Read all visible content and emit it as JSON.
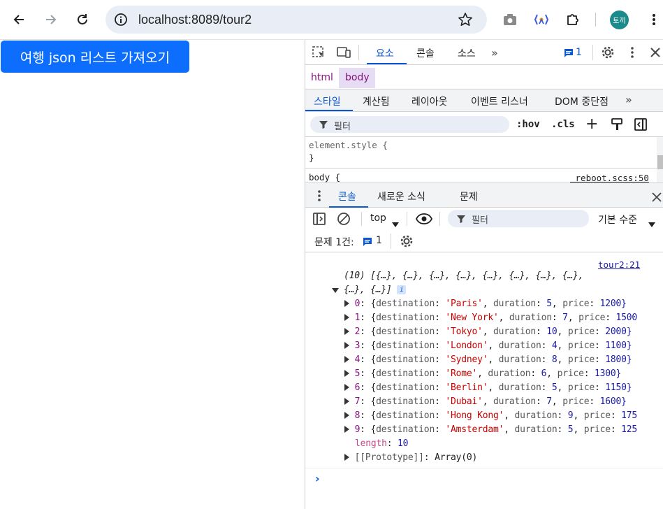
{
  "browser": {
    "url": "localhost:8089/tour2",
    "avatar_text": "토끼"
  },
  "page": {
    "fetch_button_label": "여행 json 리스트 가져오기",
    "button_color": "#0d6efd"
  },
  "devtools": {
    "top_tabs": [
      "요소",
      "콘솔",
      "소스"
    ],
    "issues_count": "1",
    "breadcrumb": [
      "html",
      "body"
    ],
    "styles_tabs": [
      "스타일",
      "계산됨",
      "레이아웃",
      "이벤트 리스너",
      "DOM 중단점"
    ],
    "filter_placeholder": "필터",
    "hov_label": ":hov",
    "cls_label": ".cls",
    "element_style_line1": "element.style {",
    "element_style_line2": "}",
    "body_rule": "body {",
    "body_source": "_reboot.scss:50",
    "drawer_tabs": [
      "콘솔",
      "새로운 소식",
      "문제"
    ],
    "console_context": "top",
    "console_filter_placeholder": "필터",
    "console_level": "기본 수준",
    "issues_label": "문제 1건:",
    "issues_badge_count": "1",
    "log_source": "tour2:21",
    "array_summary_line1": "(10) [{…}, {…}, {…}, {…}, {…}, {…}, {…}, {…},",
    "array_summary_line2": "{…}, {…}]",
    "items": [
      {
        "index": "0",
        "destination": "'Paris'",
        "duration": "5",
        "price": "1200}"
      },
      {
        "index": "1",
        "destination": "'New York'",
        "duration": "7",
        "price": "1500"
      },
      {
        "index": "2",
        "destination": "'Tokyo'",
        "duration": "10",
        "price": "2000}"
      },
      {
        "index": "3",
        "destination": "'London'",
        "duration": "4",
        "price": "1100}"
      },
      {
        "index": "4",
        "destination": "'Sydney'",
        "duration": "8",
        "price": "1800}"
      },
      {
        "index": "5",
        "destination": "'Rome'",
        "duration": "6",
        "price": "1300}"
      },
      {
        "index": "6",
        "destination": "'Berlin'",
        "duration": "5",
        "price": "1150}"
      },
      {
        "index": "7",
        "destination": "'Dubai'",
        "duration": "7",
        "price": "1600}"
      },
      {
        "index": "8",
        "destination": "'Hong Kong'",
        "duration": "9",
        "price": "175"
      },
      {
        "index": "9",
        "destination": "'Amsterdam'",
        "duration": "5",
        "price": "125"
      }
    ],
    "length_key": "length",
    "length_value": "10",
    "prototype_key": "[[Prototype]]",
    "prototype_value": "Array(0)"
  }
}
